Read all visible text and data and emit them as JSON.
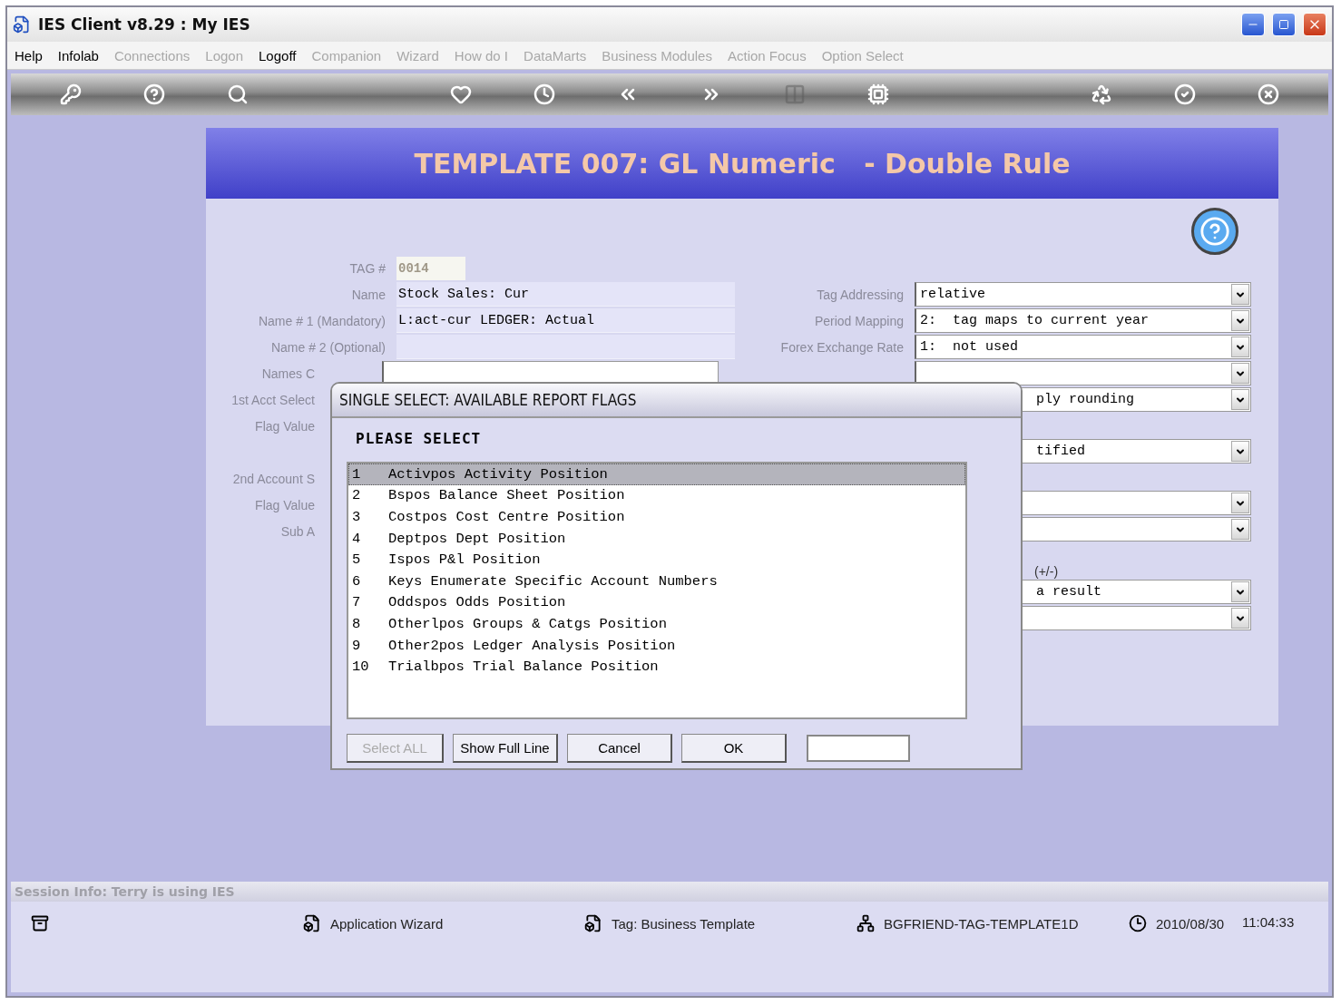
{
  "window": {
    "title": "IES Client v8.29 : My IES"
  },
  "menu": [
    {
      "label": "Help",
      "disabled": false
    },
    {
      "label": "Infolab",
      "disabled": false
    },
    {
      "label": "Connections",
      "disabled": true
    },
    {
      "label": "Logon",
      "disabled": true
    },
    {
      "label": "Logoff",
      "disabled": false
    },
    {
      "label": "Companion",
      "disabled": true
    },
    {
      "label": "Wizard",
      "disabled": true
    },
    {
      "label": "How do I",
      "disabled": true
    },
    {
      "label": "DataMarts",
      "disabled": true
    },
    {
      "label": "Business Modules",
      "disabled": true
    },
    {
      "label": "Action Focus",
      "disabled": true
    },
    {
      "label": "Option Select",
      "disabled": true
    }
  ],
  "toolbar": [
    {
      "kind": "key",
      "disabled": false
    },
    {
      "kind": "help",
      "disabled": false
    },
    {
      "kind": "search",
      "disabled": false
    },
    {
      "kind": "spacer"
    },
    {
      "kind": "heart",
      "disabled": false
    },
    {
      "kind": "clock",
      "disabled": false
    },
    {
      "kind": "back",
      "disabled": false
    },
    {
      "kind": "forward",
      "disabled": false
    },
    {
      "kind": "columns",
      "disabled": true
    },
    {
      "kind": "chip",
      "disabled": false
    },
    {
      "kind": "spacer"
    },
    {
      "kind": "recycle",
      "disabled": false
    },
    {
      "kind": "check",
      "disabled": false
    },
    {
      "kind": "close",
      "disabled": false
    }
  ],
  "panel": {
    "title": "TEMPLATE 007: GL Numeric   - Double Rule",
    "left_rows": [
      {
        "kind": "tag",
        "label": "TAG #",
        "value": "0014"
      },
      {
        "kind": "text",
        "label": "Name",
        "value": "Stock Sales: Cur"
      },
      {
        "kind": "text",
        "label": "Name # 1 (Mandatory)",
        "value": "L:act-cur LEDGER: Actual"
      },
      {
        "kind": "text",
        "label": "Name # 2  (Optional)",
        "value": ""
      },
      {
        "kind": "select",
        "label": "Names C"
      },
      {
        "kind": "label",
        "label": "1st Acct Select"
      },
      {
        "kind": "label",
        "label": "Flag Value"
      },
      {
        "kind": "gap"
      },
      {
        "kind": "label",
        "label": "2nd Account S"
      },
      {
        "kind": "label",
        "label": "Flag Value"
      },
      {
        "kind": "label",
        "label": "Sub A"
      }
    ],
    "right_rows": [
      {
        "kind": "select",
        "label": "Tag Addressing",
        "value": "relative"
      },
      {
        "kind": "select",
        "label": "Period Mapping",
        "value": "2:  tag maps to current year"
      },
      {
        "kind": "select",
        "label": "Forex Exchange Rate",
        "value": "1:  not used"
      },
      {
        "kind": "covered"
      },
      {
        "kind": "partial",
        "value": "ply rounding"
      },
      {
        "kind": "gap"
      },
      {
        "kind": "partial",
        "value": "tified"
      },
      {
        "kind": "gap"
      },
      {
        "kind": "partial",
        "value": ""
      },
      {
        "kind": "partial",
        "value": ""
      },
      {
        "kind": "note",
        "value": "(+/-)"
      },
      {
        "kind": "partial",
        "value": "a result"
      },
      {
        "kind": "partial",
        "value": ""
      }
    ]
  },
  "dialog": {
    "title": "SINGLE SELECT: AVAILABLE REPORT FLAGS",
    "prompt": "PLEASE SELECT",
    "items": [
      {
        "number": "1",
        "text": "Activpos Activity Position",
        "selected": true
      },
      {
        "number": "2",
        "text": "Bspos Balance Sheet Position",
        "selected": false
      },
      {
        "number": "3",
        "text": "Costpos Cost Centre Position",
        "selected": false
      },
      {
        "number": "4",
        "text": "Deptpos Dept Position",
        "selected": false
      },
      {
        "number": "5",
        "text": "Ispos P&l Position",
        "selected": false
      },
      {
        "number": "6",
        "text": "Keys Enumerate Specific Account Numbers",
        "selected": false
      },
      {
        "number": "7",
        "text": "Oddspos Odds Position",
        "selected": false
      },
      {
        "number": "8",
        "text": "Otherlpos Groups & Catgs Position",
        "selected": false
      },
      {
        "number": "9",
        "text": "Other2pos Ledger Analysis Position",
        "selected": false
      },
      {
        "number": "10",
        "text": "Trialbpos Trial Balance Position",
        "selected": false
      }
    ],
    "buttons": [
      {
        "label": "Select ALL",
        "disabled": true
      },
      {
        "label": "Show Full Line",
        "disabled": false
      },
      {
        "label": "Cancel",
        "disabled": false
      },
      {
        "label": "OK",
        "disabled": false
      }
    ]
  },
  "session_info": "Session Info: Terry is using IES",
  "status_bar": [
    {
      "kind": "cabinet"
    },
    {
      "kind": "wizard",
      "label": "Application Wizard"
    },
    {
      "kind": "template",
      "label": "Tag: Business Template"
    },
    {
      "kind": "network",
      "label": "BGFRIEND-TAG-TEMPLATE1D"
    },
    {
      "kind": "clock",
      "label": "2010/08/30"
    },
    {
      "kind": "time",
      "label": "11:04:33"
    }
  ]
}
